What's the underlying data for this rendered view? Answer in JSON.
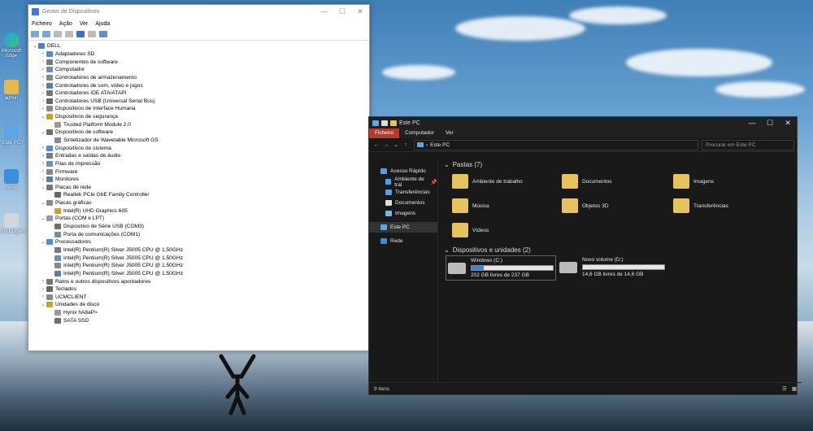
{
  "desktop": {
    "icons": [
      "Microsoft Edge",
      "admin",
      "Este PC",
      "Rede",
      "Reciclagem"
    ]
  },
  "device_manager": {
    "title": "Gestor de Dispositivos",
    "menu": [
      "Ficheiro",
      "Ação",
      "Ver",
      "Ajuda"
    ],
    "tree": [
      {
        "label": "DELL",
        "level": 0,
        "chev": "v"
      },
      {
        "label": "Adaptadores SD",
        "level": 1,
        "chev": ">"
      },
      {
        "label": "Componentes de software",
        "level": 1,
        "chev": ">"
      },
      {
        "label": "Computador",
        "level": 1,
        "chev": ">"
      },
      {
        "label": "Controladores de armazenamento",
        "level": 1,
        "chev": ">"
      },
      {
        "label": "Controladores de som, vídeo e jogos",
        "level": 1,
        "chev": ">"
      },
      {
        "label": "Controladores IDE ATA/ATAPI",
        "level": 1,
        "chev": ">"
      },
      {
        "label": "Controladores USB (Universal Serial Bus)",
        "level": 1,
        "chev": ">"
      },
      {
        "label": "Dispositivos de Interface Humana",
        "level": 1,
        "chev": ">"
      },
      {
        "label": "Dispositivos de segurança",
        "level": 1,
        "chev": "v"
      },
      {
        "label": "Trusted Platform Module 2.0",
        "level": 2,
        "chev": ""
      },
      {
        "label": "Dispositivos de software",
        "level": 1,
        "chev": "v"
      },
      {
        "label": "Sintetizador de Wavetable Microsoft GS",
        "level": 2,
        "chev": ""
      },
      {
        "label": "Dispositivos do sistema",
        "level": 1,
        "chev": ">"
      },
      {
        "label": "Entradas e saídas de áudio",
        "level": 1,
        "chev": ">"
      },
      {
        "label": "Filas de impressão",
        "level": 1,
        "chev": ">"
      },
      {
        "label": "Firmware",
        "level": 1,
        "chev": ">"
      },
      {
        "label": "Monitores",
        "level": 1,
        "chev": ">"
      },
      {
        "label": "Placas de rede",
        "level": 1,
        "chev": "v"
      },
      {
        "label": "Realtek PCIe GbE Family Controller",
        "level": 2,
        "chev": ""
      },
      {
        "label": "Placas gráficas",
        "level": 1,
        "chev": "v"
      },
      {
        "label": "Intel(R) UHD Graphics 605",
        "level": 2,
        "chev": ""
      },
      {
        "label": "Portas (COM e LPT)",
        "level": 1,
        "chev": "v"
      },
      {
        "label": "Dispositivo de Série USB (COM3)",
        "level": 2,
        "chev": ""
      },
      {
        "label": "Porta de comunicações (COM1)",
        "level": 2,
        "chev": ""
      },
      {
        "label": "Processadores",
        "level": 1,
        "chev": "v"
      },
      {
        "label": "Intel(R) Pentium(R) Silver J5005 CPU @ 1.50GHz",
        "level": 2,
        "chev": ""
      },
      {
        "label": "Intel(R) Pentium(R) Silver J5005 CPU @ 1.50GHz",
        "level": 2,
        "chev": ""
      },
      {
        "label": "Intel(R) Pentium(R) Silver J5005 CPU @ 1.50GHz",
        "level": 2,
        "chev": ""
      },
      {
        "label": "Intel(R) Pentium(R) Silver J5005 CPU @ 1.50GHz",
        "level": 2,
        "chev": ""
      },
      {
        "label": "Ratos e outros dispositivos apontadores",
        "level": 1,
        "chev": ">"
      },
      {
        "label": "Teclados",
        "level": 1,
        "chev": ">"
      },
      {
        "label": "UCMCLIENT",
        "level": 1,
        "chev": ">"
      },
      {
        "label": "Unidades de disco",
        "level": 1,
        "chev": "v"
      },
      {
        "label": "Hynix hA8aP>",
        "level": 2,
        "chev": ""
      },
      {
        "label": "SATA SSD",
        "level": 2,
        "chev": ""
      }
    ]
  },
  "explorer": {
    "title": "Este PC",
    "ribbon": [
      "Ficheiro",
      "Computador",
      "Ver"
    ],
    "address": "Este PC",
    "search_placeholder": "Procurar em Este PC",
    "nav": [
      {
        "label": "Acesso Rápido",
        "pin": false
      },
      {
        "label": "Ambiente de tral",
        "pin": true
      },
      {
        "label": "Transferências",
        "pin": true
      },
      {
        "label": "Documentos",
        "pin": true
      },
      {
        "label": "Imagens",
        "pin": true
      },
      {
        "label": "Este PC",
        "pin": false
      },
      {
        "label": "Rede",
        "pin": false
      }
    ],
    "folders_header": "Pastas (7)",
    "folders": [
      "Ambiente de trabalho",
      "Documentos",
      "Imagens",
      "Música",
      "Objetos 3D",
      "Transferências",
      "Vídeos"
    ],
    "drives_header": "Dispositivos e unidades (2)",
    "drives": [
      {
        "name": "Windows (C:)",
        "free": "202 GB livres de 237 GB",
        "used_fraction": 0.15
      },
      {
        "name": "Novo volume (D:)",
        "free": "14,6 GB livres de 14,6 GB",
        "used_fraction": 0.0
      }
    ],
    "status": "9 itens"
  }
}
